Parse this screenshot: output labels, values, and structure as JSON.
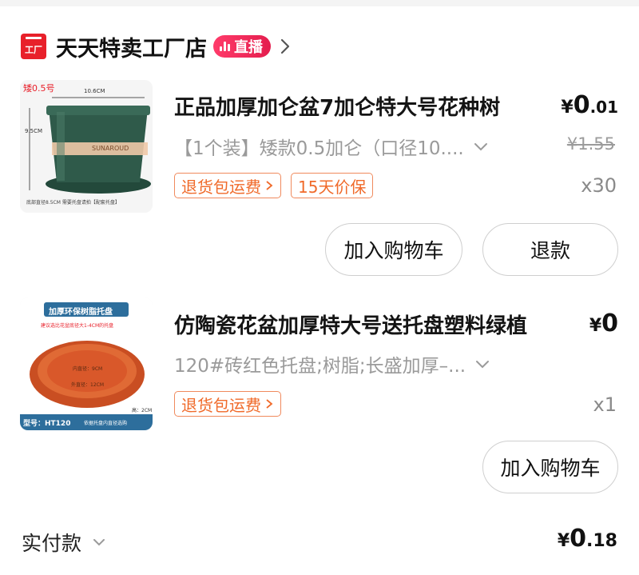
{
  "shop": {
    "logo_text": "工厂",
    "name": "天天特卖工厂店",
    "live_badge": "直播"
  },
  "items": [
    {
      "image": {
        "tag": "矮0.5号",
        "width_label": "10.6CM",
        "height_label": "9.5CM",
        "brand": "SUNAROUD",
        "bottom_note": "底部直径8.5CM  需要托盘请拍【配套托盘】"
      },
      "title": "正品加厚加仑盆7加仑特大号花种树",
      "price": {
        "currency": "¥",
        "integer": "0",
        "decimal": ".01"
      },
      "variant": "【1个装】矮款0.5加仑（口径10....",
      "old_price": "¥1.55",
      "tags": [
        "退货包运费",
        "15天价保"
      ],
      "quantity": "x30",
      "buttons": [
        "加入购物车",
        "退款"
      ]
    },
    {
      "image": {
        "banner": "加厚环保树脂托盘",
        "subtitle": "建议选比花盆底径大1-4CM的托盘",
        "inner_label": "内直径：9CM",
        "outer_label": "外直径：12CM",
        "height_label": "高：2CM",
        "model_badge": "型号：HT120",
        "model_note": "依据托盘内直径选购"
      },
      "title": "仿陶瓷花盆加厚特大号送托盘塑料绿植",
      "price": {
        "currency": "¥",
        "integer": "0",
        "decimal": ""
      },
      "variant": "120#砖红色托盘;树脂;长盛加厚–...",
      "tags": [
        "退货包运费"
      ],
      "quantity": "x1",
      "buttons": [
        "加入购物车"
      ]
    }
  ],
  "footer": {
    "label": "实付款",
    "total": {
      "currency": "¥",
      "integer": "0",
      "decimal": ".18"
    }
  },
  "colors": {
    "brand_red": "#e8202a",
    "live_pink": "#ff3b6a",
    "tag_orange": "#f06a2a",
    "pot_green": "#2f5a4a",
    "tray_orange": "#d9582a"
  }
}
